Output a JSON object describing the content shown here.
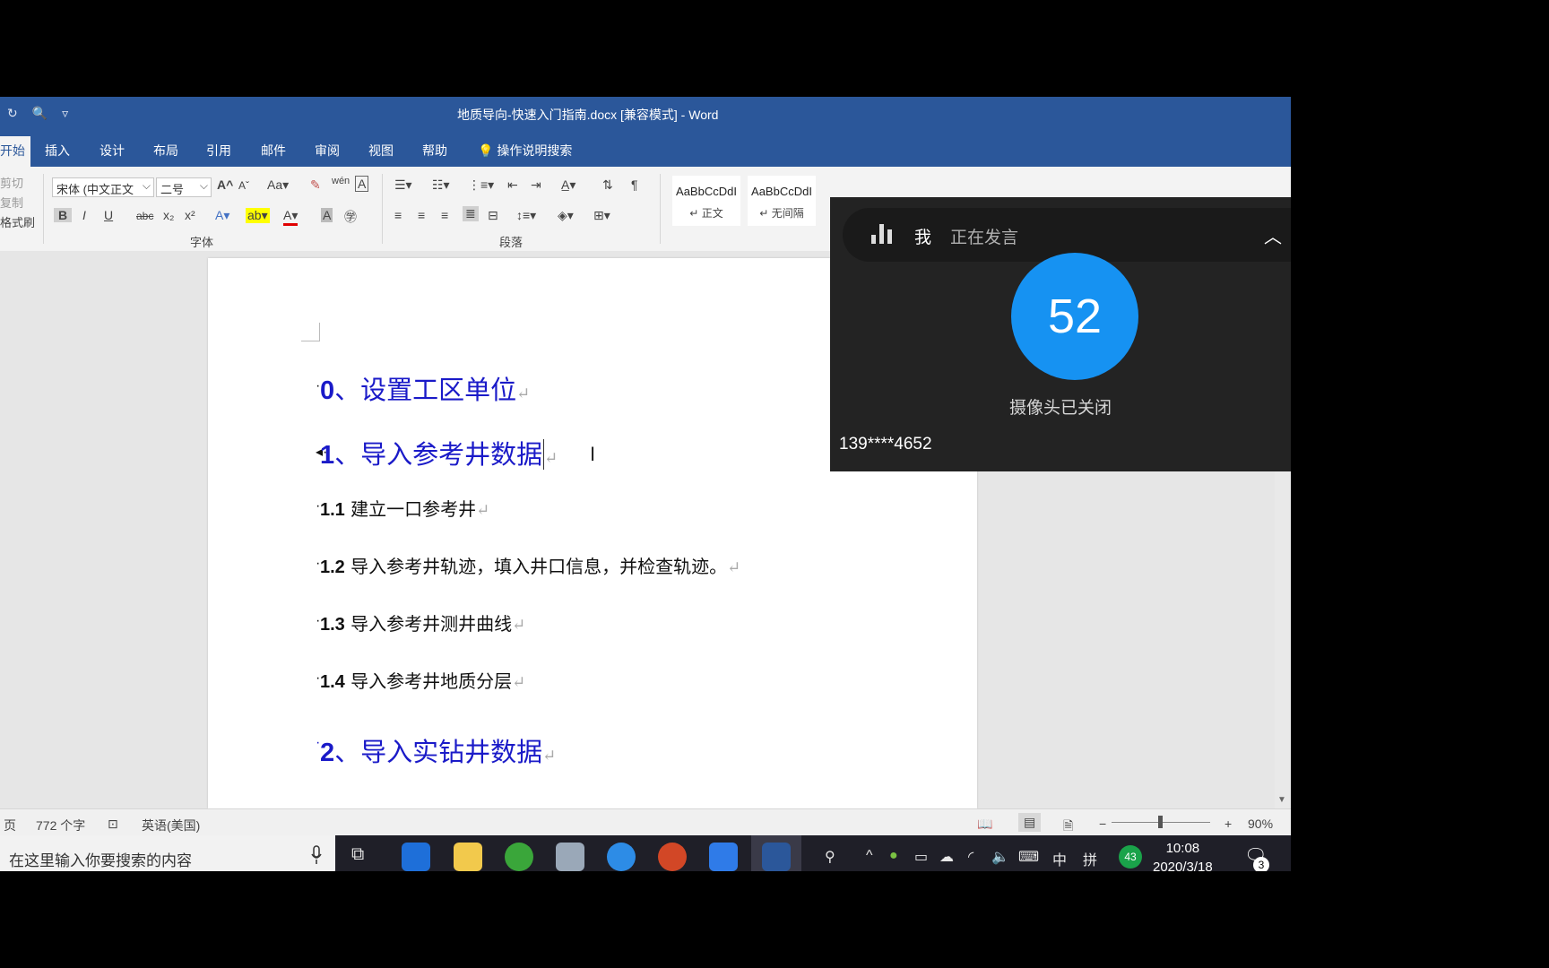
{
  "window": {
    "title": "地质导向-快速入门指南.docx [兼容模式]  -  Word"
  },
  "tabs": [
    {
      "label": "开始",
      "active": true
    },
    {
      "label": "插入"
    },
    {
      "label": "设计"
    },
    {
      "label": "布局"
    },
    {
      "label": "引用"
    },
    {
      "label": "邮件"
    },
    {
      "label": "审阅"
    },
    {
      "label": "视图"
    },
    {
      "label": "帮助"
    }
  ],
  "tell_me": "操作说明搜索",
  "ribbon": {
    "clipboard": {
      "cut": "剪切",
      "copy": "复制",
      "format_painter": "格式刷"
    },
    "font": {
      "name": "宋体 (中文正文",
      "size": "二号",
      "label": "字体",
      "buttons": {
        "bold": "B",
        "italic": "I",
        "underline": "U",
        "strike": "abc",
        "sub": "x₂",
        "sup": "x²",
        "case": "Aa",
        "grow": "A",
        "shrink": "A"
      }
    },
    "paragraph": {
      "label": "段落"
    },
    "styles": [
      {
        "preview": "AaBbCcDdI",
        "name": "正文"
      },
      {
        "preview": "AaBbCcDdI",
        "name": "无间隔"
      }
    ]
  },
  "document": {
    "headings": [
      {
        "num": "0",
        "text": "、设置工区单位"
      },
      {
        "num": "1",
        "text": "、导入参考井数据"
      },
      {
        "num": "2",
        "text": "、导入实钻井数据"
      }
    ],
    "subs": [
      {
        "num": "1.1",
        "text": " 建立一口参考井"
      },
      {
        "num": "1.2",
        "text": " 导入参考井轨迹，填入井口信息，并检查轨迹。"
      },
      {
        "num": "1.3",
        "text": " 导入参考井测井曲线"
      },
      {
        "num": "1.4",
        "text": "  导入参考井地质分层"
      }
    ],
    "return_mark": "↵"
  },
  "statusbar": {
    "page": "页",
    "word_count": "772 个字",
    "language": "英语(美国)",
    "zoom": "90%",
    "zoom_minus": "−",
    "zoom_plus": "+"
  },
  "taskbar": {
    "search_placeholder": "在这里输入你要搜索的内容",
    "ime": "中",
    "ime2": "拼",
    "badge": "43",
    "time": "10:08",
    "date": "2020/3/18",
    "notification_count": "3"
  },
  "meeting": {
    "me": "我",
    "status": "正在发言",
    "avatar_number": "52",
    "camera": "摄像头已关闭",
    "phone": "139****4652"
  },
  "colors": {
    "word_blue": "#2b579a",
    "heading_blue": "#1a1ac8",
    "avatar_blue": "#1692f2"
  }
}
